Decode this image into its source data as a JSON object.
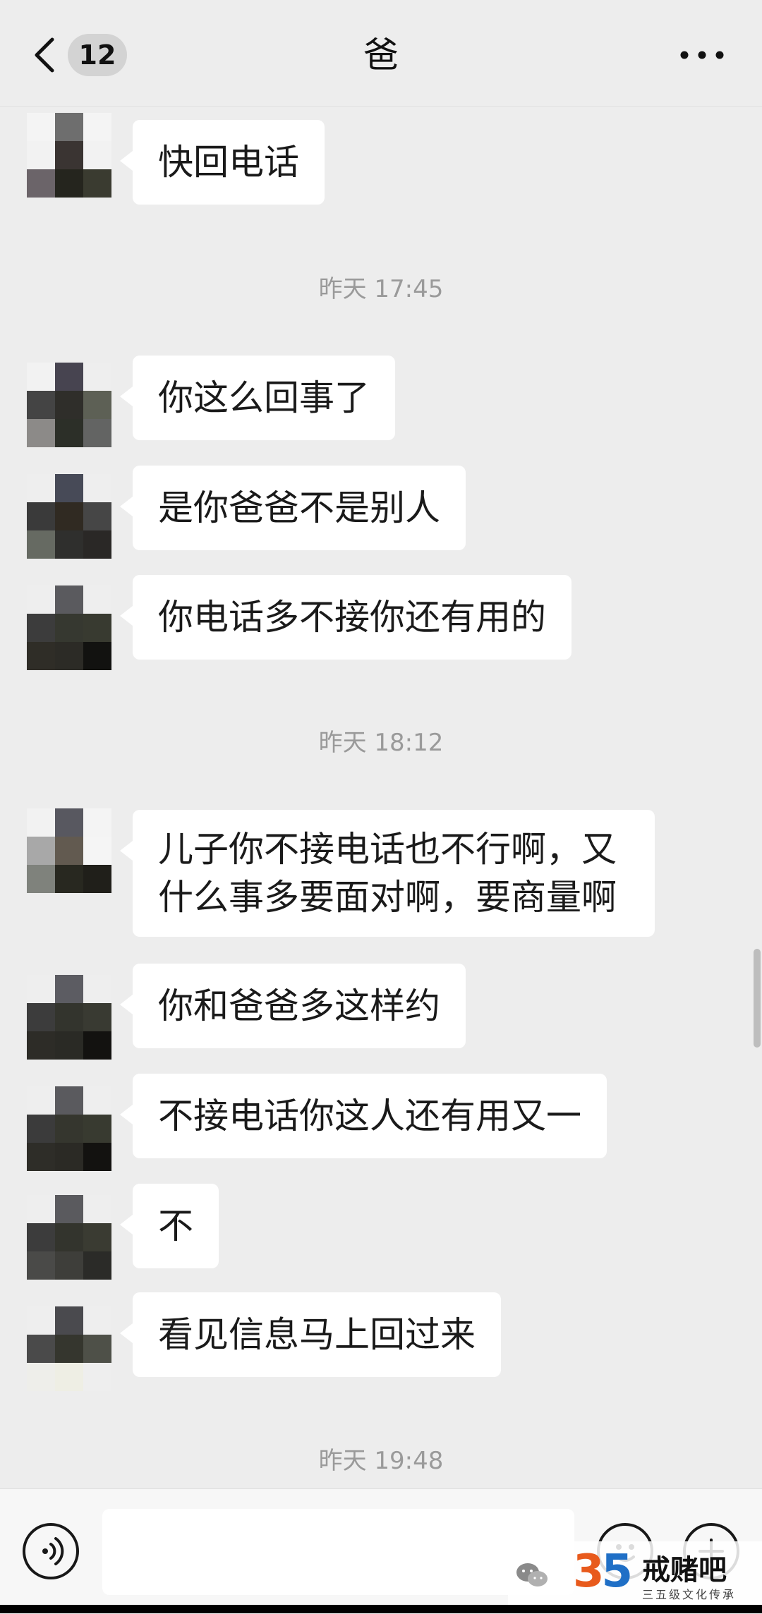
{
  "header": {
    "back_icon": "chevron-left-icon",
    "unread_count": "12",
    "title": "爸",
    "more_icon": "more-horizontal-icon"
  },
  "messages": [
    {
      "type": "received",
      "text": "快回电话"
    },
    {
      "type": "time",
      "text": "昨天 17:45"
    },
    {
      "type": "received",
      "text": "你这么回事了"
    },
    {
      "type": "received",
      "text": "是你爸爸不是别人"
    },
    {
      "type": "received",
      "text": "你电话多不接你还有用的"
    },
    {
      "type": "time",
      "text": "昨天 18:12"
    },
    {
      "type": "received",
      "text": "儿子你不接电话也不行啊，又什么事多要面对啊，要商量啊"
    },
    {
      "type": "received",
      "text": "你和爸爸多这样约"
    },
    {
      "type": "received",
      "text": "不接电话你这人还有用又一"
    },
    {
      "type": "received",
      "text": "不"
    },
    {
      "type": "received",
      "text": "看见信息马上回过来"
    },
    {
      "type": "time",
      "text": "昨天 19:48"
    }
  ],
  "input_bar": {
    "voice_icon": "voice-icon",
    "input_value": "",
    "emoji_icon": "emoji-icon",
    "plus_icon": "plus-icon"
  },
  "watermark": {
    "wechat_icon": "wechat-icon",
    "digit_3": "3",
    "digit_5": "5",
    "brand": "戒赌吧",
    "subtitle": "三五级文化传承"
  }
}
